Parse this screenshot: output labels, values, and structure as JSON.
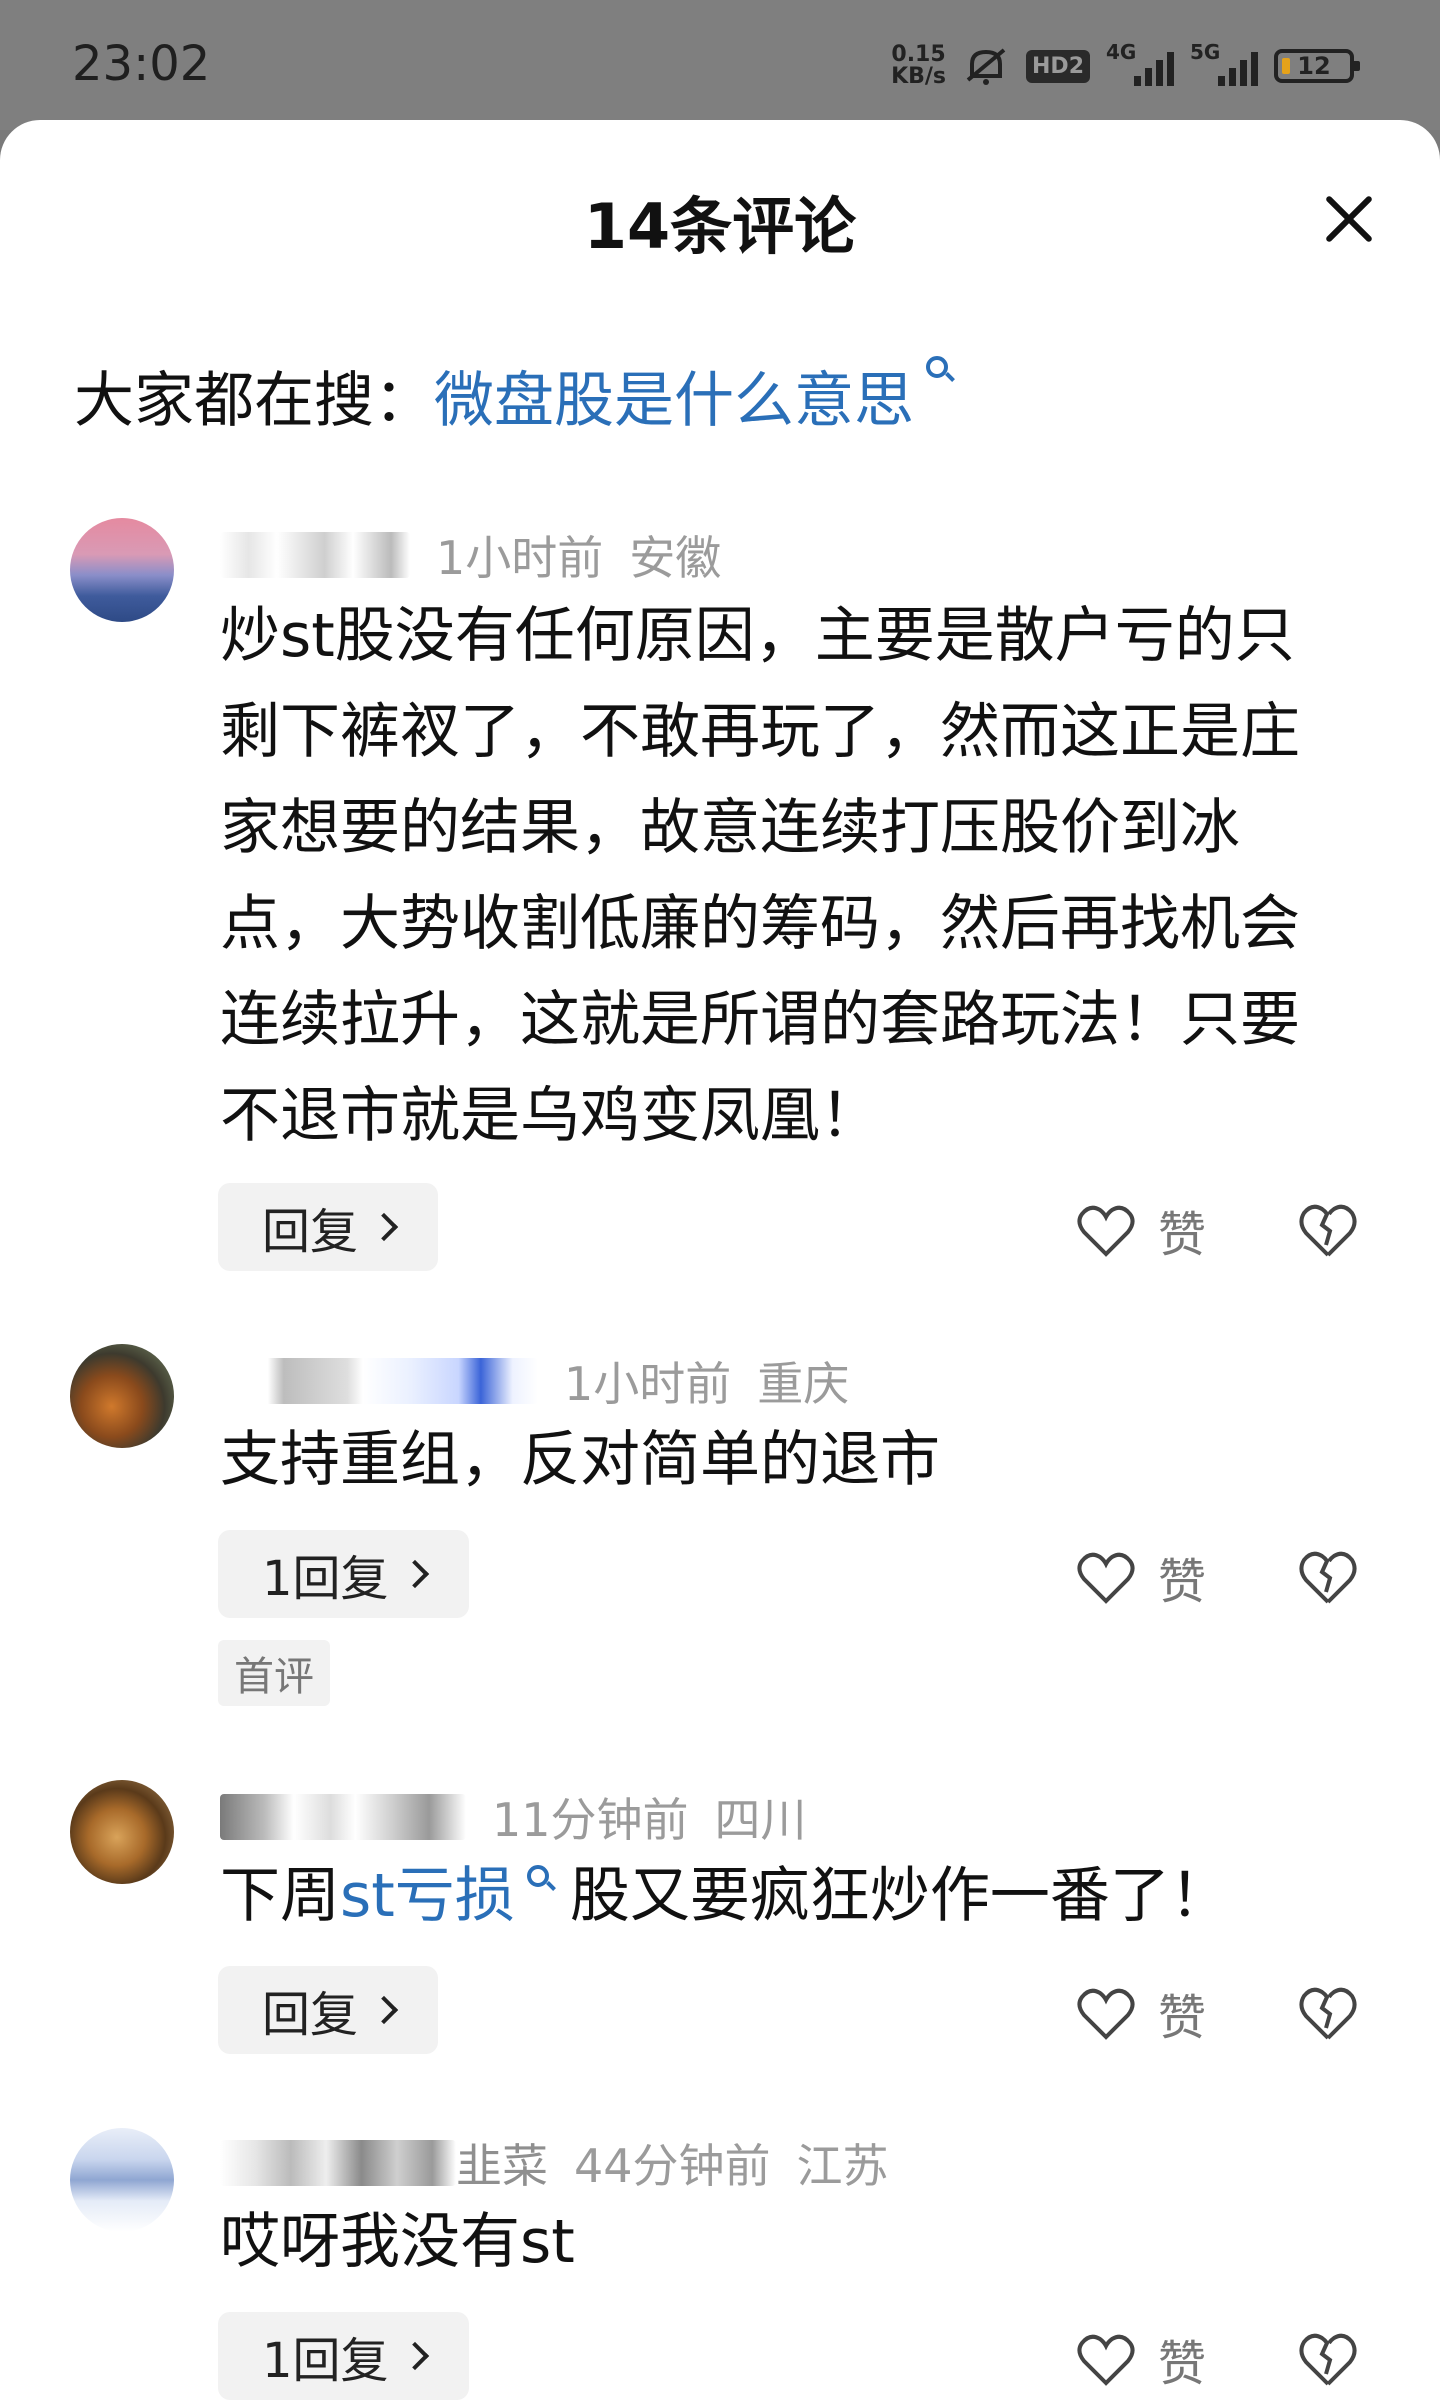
{
  "status_bar": {
    "time": "23:02",
    "net_speed_value": "0.15",
    "net_speed_unit": "KB/s",
    "hd_badge": "HD2",
    "signal1_label": "4G",
    "signal2_label": "5G",
    "battery": "12"
  },
  "sheet": {
    "title": "14条评论"
  },
  "hot_search": {
    "prefix": "大家都在搜：",
    "query": "微盘股是什么意思"
  },
  "comments": [
    {
      "time": "1小时前",
      "location": "安徽",
      "text": "炒st股没有任何原因，主要是散户亏的只剩下裤衩了，不敢再玩了，然而这正是庄家想要的结果，故意连续打压股价到冰点，大势收割低廉的筹码，然后再找机会连续拉升，这就是所谓的套路玩法！只要不退市就是乌鸡变凤凰！",
      "reply_label": "回复",
      "like_label": "赞"
    },
    {
      "time": "1小时前",
      "location": "重庆",
      "text": "支持重组，反对简单的退市",
      "reply_label": "1回复",
      "like_label": "赞",
      "tag": "首评"
    },
    {
      "time": "11分钟前",
      "location": "四川",
      "text_before": "下周",
      "text_link": "st亏损",
      "text_after": " 股又要疯狂炒作一番了！",
      "reply_label": "回复",
      "like_label": "赞"
    },
    {
      "name_suffix": "韭菜",
      "time": "44分钟前",
      "location": "江苏",
      "text": "哎呀我没有st",
      "reply_label": "1回复",
      "like_label": "赞"
    }
  ],
  "icons": {
    "close": "close-icon",
    "search": "search-icon",
    "like": "heart-outline-icon",
    "dislike": "broken-heart-icon",
    "chevron": "chevron-right-icon"
  },
  "colors": {
    "link": "#2a6fb8",
    "meta": "#9b9b9b",
    "reply_bg": "#f2f2f2"
  }
}
